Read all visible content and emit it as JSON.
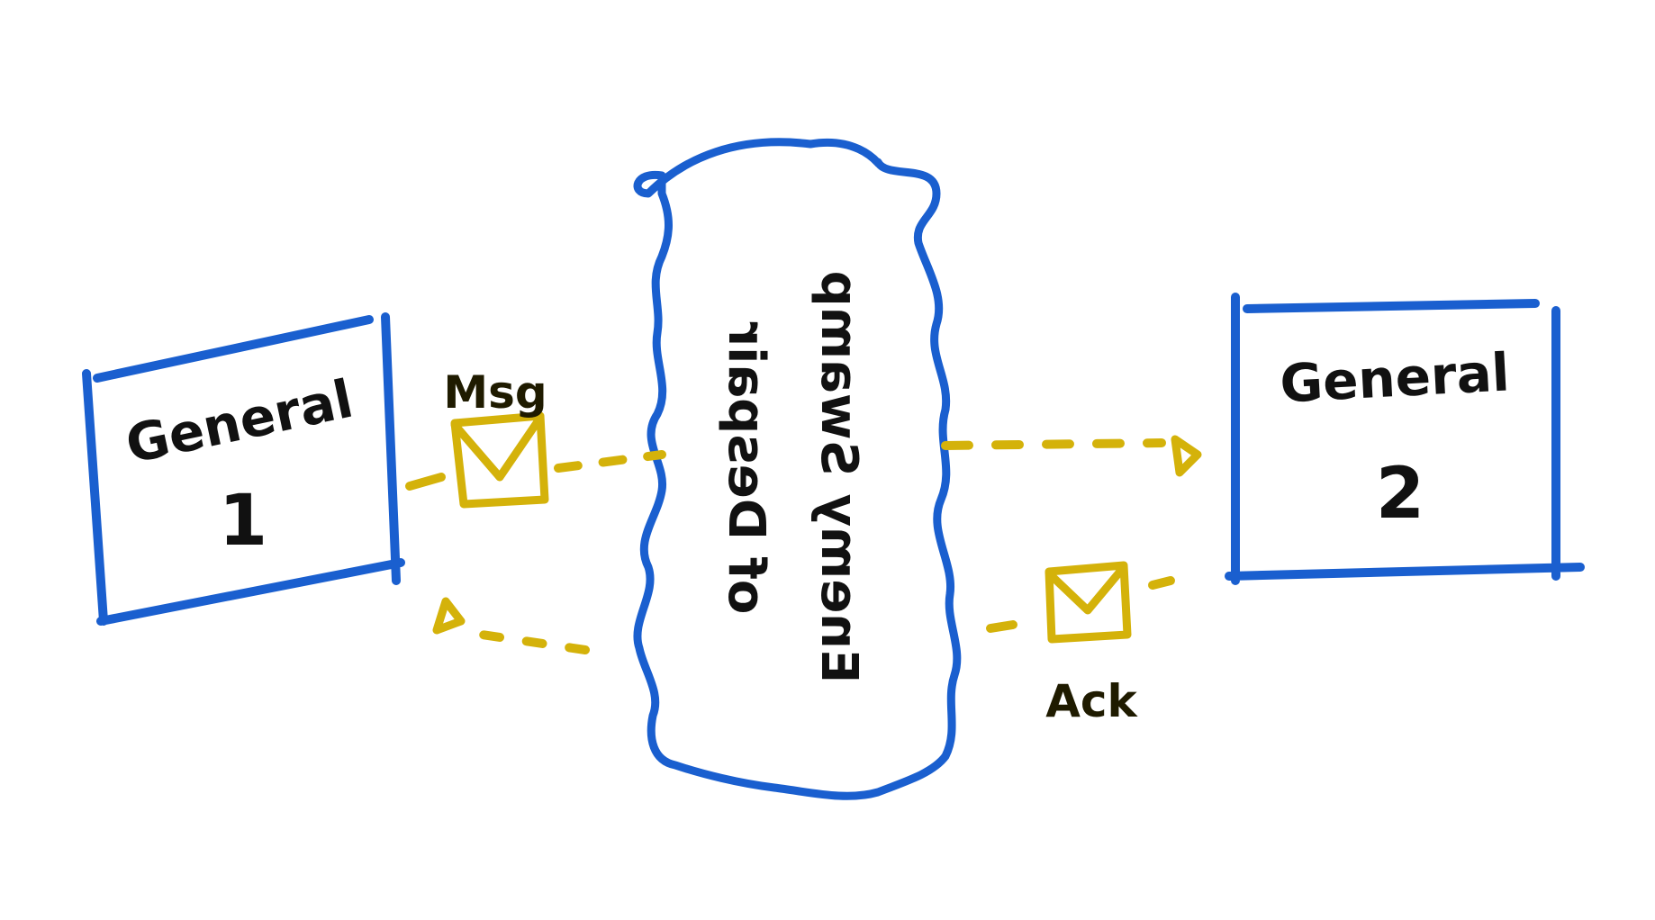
{
  "colors": {
    "box_stroke": "#1a5fcf",
    "message_color": "#d4b20a",
    "ink": "#111111"
  },
  "general_1": {
    "line1": "General",
    "line2": "1"
  },
  "general_2": {
    "line1": "General",
    "line2": "2"
  },
  "swamp": {
    "line1": "Enemy Swamp",
    "line2": "of Despair"
  },
  "message": {
    "label": "Msg",
    "icon": "envelope-icon"
  },
  "ack": {
    "label": "Ack",
    "icon": "envelope-icon"
  }
}
